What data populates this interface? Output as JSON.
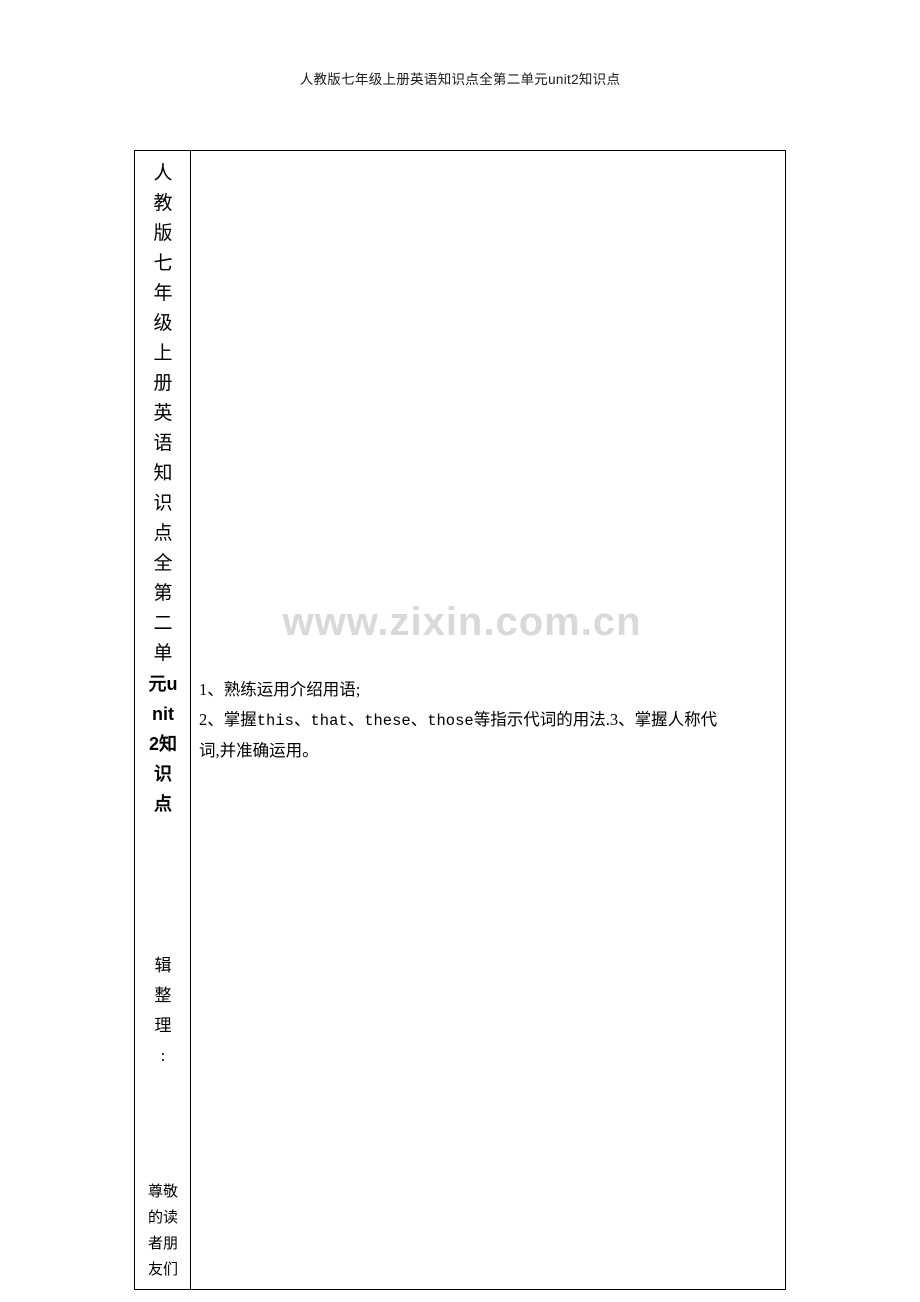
{
  "document": {
    "header_text": "人教版七年级上册英语知识点全第二单元unit2知识点",
    "watermark": "www.zixin.com.cn",
    "table": {
      "left_column": {
        "title_chars": [
          "人",
          "教",
          "版",
          "七",
          "年",
          "级",
          "上",
          "册",
          "英",
          "语",
          "知",
          "识",
          "点",
          "全",
          "第",
          "二",
          "单"
        ],
        "title_bold_chars": [
          "元u",
          "nit",
          "2知",
          "识",
          "点"
        ],
        "sub_chars": [
          "辑",
          "整",
          "理",
          ":"
        ],
        "foot_chars": [
          "尊敬",
          "的读",
          "者朋",
          "友们"
        ]
      },
      "right_column": {
        "line1": "1、熟练运用介绍用语;",
        "line2_part1": "2、掌握",
        "line2_mono1": "this",
        "line2_sep1": "、",
        "line2_mono2": "that",
        "line2_sep2": "、",
        "line2_mono3": "these",
        "line2_sep3": "、",
        "line2_mono4": "those",
        "line2_part2": "等指示代词的用法.3、掌握人称代",
        "line3": "词,并准确运用。"
      }
    }
  }
}
